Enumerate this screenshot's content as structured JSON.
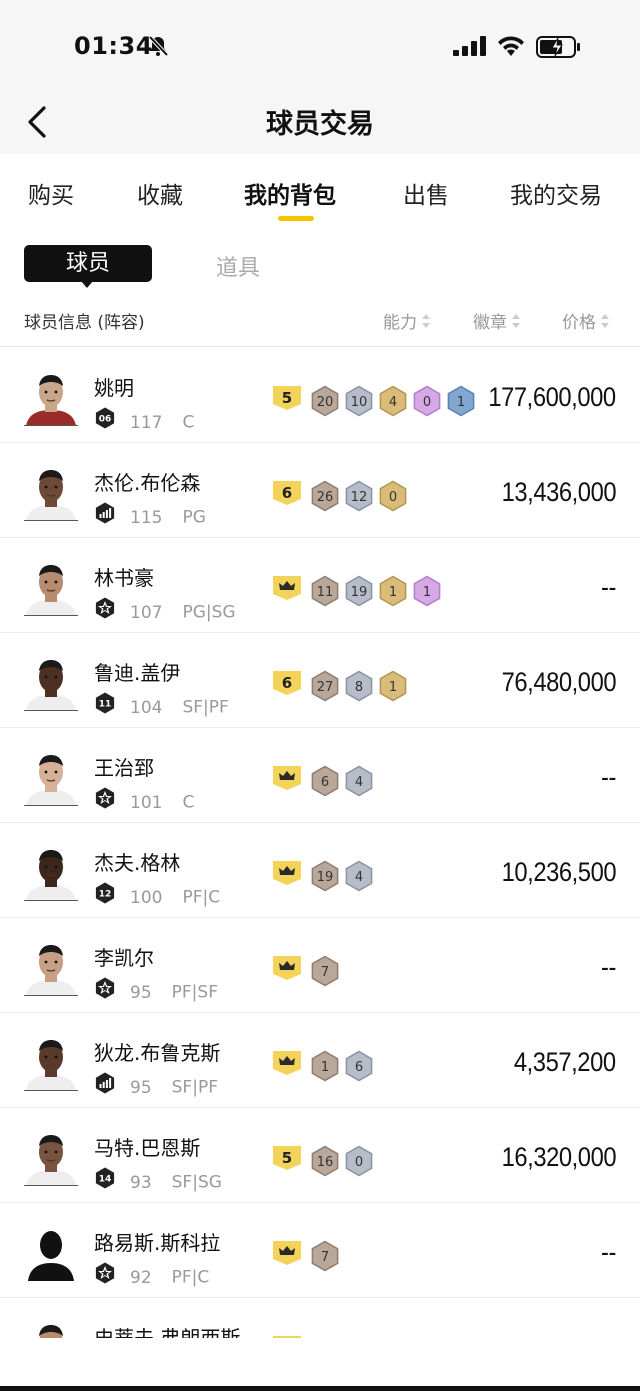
{
  "status": {
    "time": "01:34"
  },
  "nav": {
    "title": "球员交易"
  },
  "tabs": [
    {
      "label": "购买"
    },
    {
      "label": "收藏"
    },
    {
      "label": "我的背包",
      "active": true
    },
    {
      "label": "出售"
    },
    {
      "label": "我的交易"
    }
  ],
  "segments": {
    "players": "球员",
    "items": "道具"
  },
  "columns": {
    "info": "球员信息 (阵容)",
    "ability": "能力",
    "badges": "徽章",
    "price": "价格"
  },
  "players": [
    {
      "name": "姚明",
      "rank": "06",
      "ovr": "117",
      "pos": "C",
      "tier": "5",
      "badges": [
        "20",
        "10",
        "4",
        "0",
        "1"
      ],
      "price": "177,600,000"
    },
    {
      "name": "杰伦.布伦森",
      "rank": "bars",
      "ovr": "115",
      "pos": "PG",
      "tier": "6",
      "badges": [
        "26",
        "12",
        "0"
      ],
      "price": "13,436,000"
    },
    {
      "name": "林书豪",
      "rank": "star",
      "ovr": "107",
      "pos": "PG|SG",
      "tier": "crown",
      "badges": [
        "11",
        "19",
        "1",
        "1"
      ],
      "price": "--"
    },
    {
      "name": "鲁迪.盖伊",
      "rank": "11",
      "ovr": "104",
      "pos": "SF|PF",
      "tier": "6",
      "badges": [
        "27",
        "8",
        "1"
      ],
      "price": "76,480,000"
    },
    {
      "name": "王治郅",
      "rank": "star",
      "ovr": "101",
      "pos": "C",
      "tier": "crown",
      "badges": [
        "6",
        "4"
      ],
      "price": "--"
    },
    {
      "name": "杰夫.格林",
      "rank": "12",
      "ovr": "100",
      "pos": "PF|C",
      "tier": "crown",
      "badges": [
        "19",
        "4"
      ],
      "price": "10,236,500"
    },
    {
      "name": "李凯尔",
      "rank": "star",
      "ovr": "95",
      "pos": "PF|SF",
      "tier": "crown",
      "badges": [
        "7"
      ],
      "price": "--"
    },
    {
      "name": "狄龙.布鲁克斯",
      "rank": "bars",
      "ovr": "95",
      "pos": "SF|PF",
      "tier": "crown",
      "badges": [
        "1",
        "6"
      ],
      "price": "4,357,200"
    },
    {
      "name": "马特.巴恩斯",
      "rank": "14",
      "ovr": "93",
      "pos": "SF|SG",
      "tier": "5",
      "badges": [
        "16",
        "0"
      ],
      "price": "16,320,000"
    },
    {
      "name": "路易斯.斯科拉",
      "rank": "star",
      "ovr": "92",
      "pos": "PF|C",
      "tier": "crown",
      "badges": [
        "7"
      ],
      "price": "--"
    },
    {
      "name": "史蒂夫.弗朗西斯",
      "rank": "",
      "ovr": "",
      "pos": "",
      "tier": "crown",
      "badges": [],
      "price": ""
    }
  ]
}
